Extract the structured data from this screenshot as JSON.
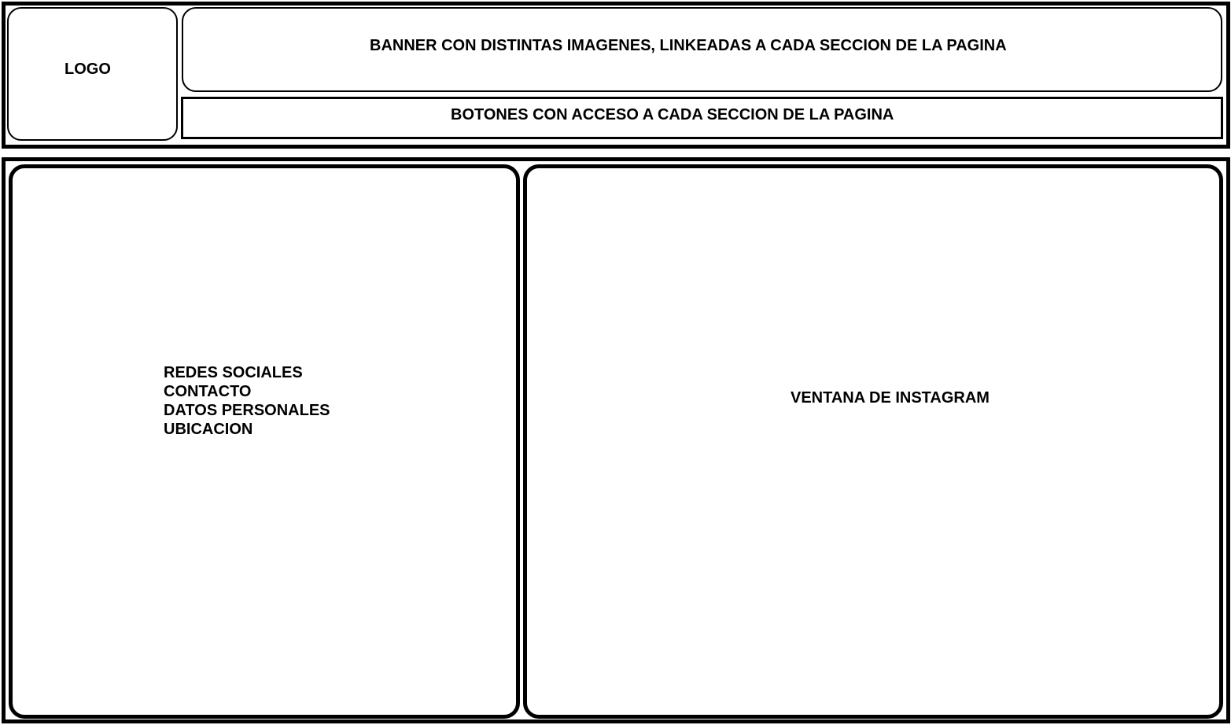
{
  "header": {
    "logo_label": "LOGO",
    "banner_label": "BANNER CON DISTINTAS IMAGENES, LINKEADAS A CADA SECCION DE LA PAGINA",
    "nav_label": "BOTONES CON ACCESO A CADA SECCION DE LA PAGINA"
  },
  "info_panel": {
    "items": [
      "REDES SOCIALES",
      "CONTACTO",
      "DATOS PERSONALES",
      "UBICACION"
    ]
  },
  "instagram_panel": {
    "label": "VENTANA DE INSTAGRAM"
  }
}
